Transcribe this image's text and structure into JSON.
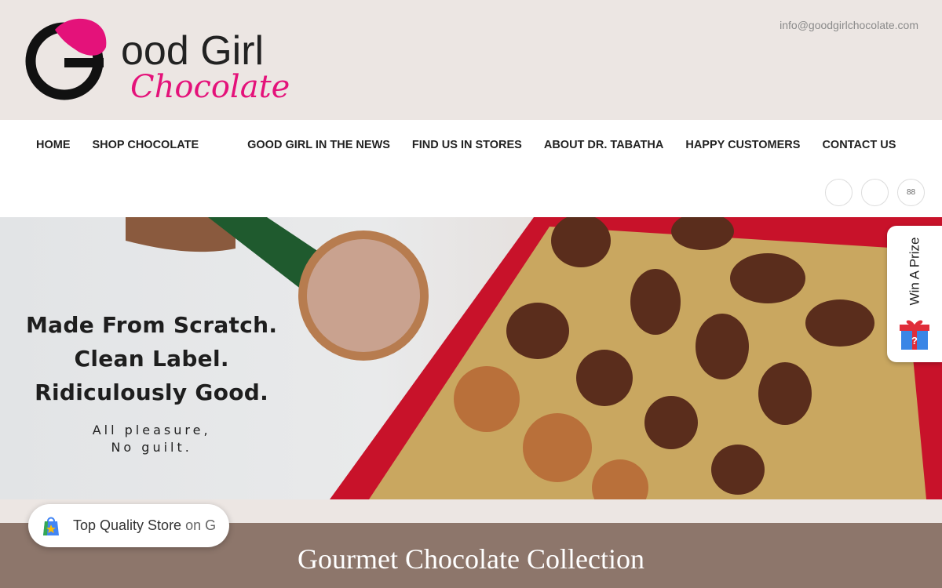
{
  "header": {
    "logo_text_1": "ood Girl",
    "logo_text_2": "Chocolate",
    "email": "info@goodgirlchocolate.com"
  },
  "nav": {
    "items": [
      "HOME",
      "SHOP CHOCOLATE",
      "GOOD GIRL IN THE NEWS",
      "FIND US IN STORES",
      "ABOUT DR. TABATHA",
      "HAPPY CUSTOMERS",
      "CONTACT US"
    ]
  },
  "social": {
    "third_label": "88"
  },
  "hero": {
    "lines": [
      "Made From Scratch.",
      "Clean Label.",
      "Ridiculously Good."
    ],
    "sub_lines": [
      "All pleasure,",
      "No guilt."
    ]
  },
  "prize": {
    "label": "Win A Prize"
  },
  "badge": {
    "label": "Top Quality Store",
    "suffix": "on G"
  },
  "section": {
    "title": "Gourmet Chocolate Collection"
  },
  "colors": {
    "brand_pink": "#e4127a",
    "brand_black": "#111111",
    "section_bg": "#8d766b",
    "header_bg": "#ece6e3"
  }
}
